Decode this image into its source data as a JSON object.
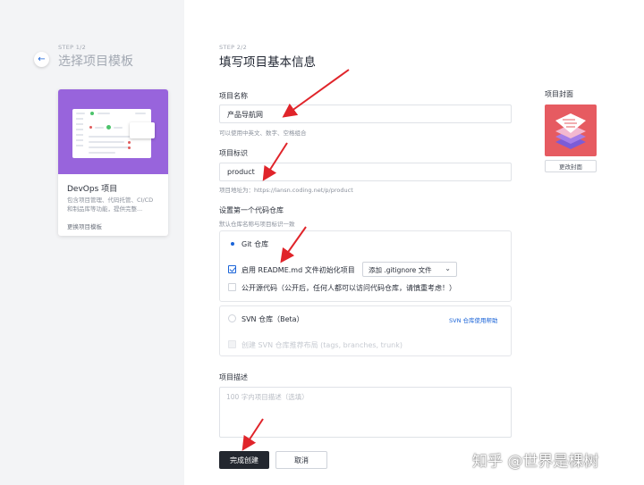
{
  "left": {
    "step": "STEP 1/2",
    "title": "选择项目模板",
    "template": {
      "name": "DevOps 项目",
      "description": "包含项目管理、代码托管、CI/CD 和制品库等功能，提供完整...",
      "change_link": "更换项目模板"
    }
  },
  "main": {
    "step": "STEP 2/2",
    "title": "填写项目基本信息",
    "project_name": {
      "label": "项目名称",
      "value": "产品导航网",
      "hint": "可以使用中英文、数字、空格组合"
    },
    "project_id": {
      "label": "项目标识",
      "value": "product",
      "hint": "项目地址为：https://lansn.coding.net/p/product"
    },
    "repo": {
      "label": "设置第一个代码仓库",
      "hint": "默认仓库名称与项目标识一致",
      "git": {
        "label": "Git 仓库",
        "readme_label": "启用 README.md 文件初始化项目",
        "gitignore_select": "添加 .gitignore 文件",
        "open_source_label": "公开源代码（公开后，任何人都可以访问代码仓库，请慎重考虑！）"
      },
      "svn": {
        "label": "SVN 仓库（Beta）",
        "help_link": "SVN 仓库使用帮助",
        "layout_label": "创建 SVN 仓库推荐布局 (tags, branches, trunk)"
      }
    },
    "description": {
      "label": "项目描述",
      "placeholder": "100 字内项目描述（选填）"
    },
    "buttons": {
      "submit": "完成创建",
      "cancel": "取消"
    }
  },
  "cover": {
    "label": "项目封面",
    "change_button": "更改封面",
    "color": "#e65b61"
  },
  "watermark": "知乎 @世界是棵树",
  "colors": {
    "accent": "#1b64d8",
    "template_cover": "#9864dc",
    "annotation_arrow": "#e0242a"
  }
}
